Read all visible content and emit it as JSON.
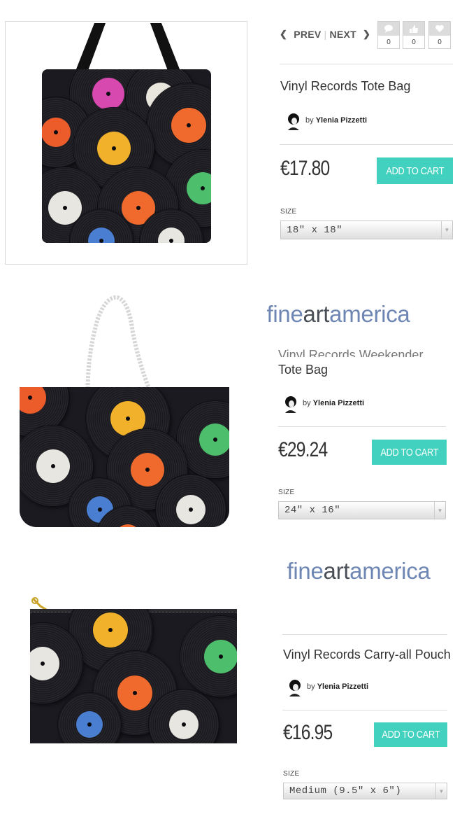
{
  "nav": {
    "prev": "PREV",
    "next": "NEXT"
  },
  "social": [
    {
      "icon": "comment-icon",
      "count": "0"
    },
    {
      "icon": "thumbs-up-icon",
      "count": "0"
    },
    {
      "icon": "heart-icon",
      "count": "0"
    }
  ],
  "watermark": {
    "part1": "fine",
    "part2": "art",
    "part3": "america"
  },
  "products": [
    {
      "title": "Vinyl Records Tote Bag",
      "by": "by",
      "artist": "Ylenia Pizzetti",
      "price": "€17.80",
      "cart": "ADD TO CART",
      "size_label": "SIZE",
      "size_value": "18\" x 18\""
    },
    {
      "title_line1": "Vinyl Records Weekender",
      "title_line2": "Tote Bag",
      "by": "by",
      "artist": "Ylenia Pizzetti",
      "price": "€29.24",
      "cart": "ADD TO CART",
      "size_label": "SIZE",
      "size_value": "24\" x 16\""
    },
    {
      "title": "Vinyl Records Carry-all Pouch",
      "by": "by",
      "artist": "Ylenia Pizzetti",
      "price": "€16.95",
      "cart": "ADD TO CART",
      "size_label": "SIZE",
      "size_value": "Medium (9.5\" x 6\")"
    }
  ],
  "colors": {
    "accent": "#43d1bf",
    "logo_blue": "#6d86b3",
    "logo_gray": "#4a4f57"
  }
}
